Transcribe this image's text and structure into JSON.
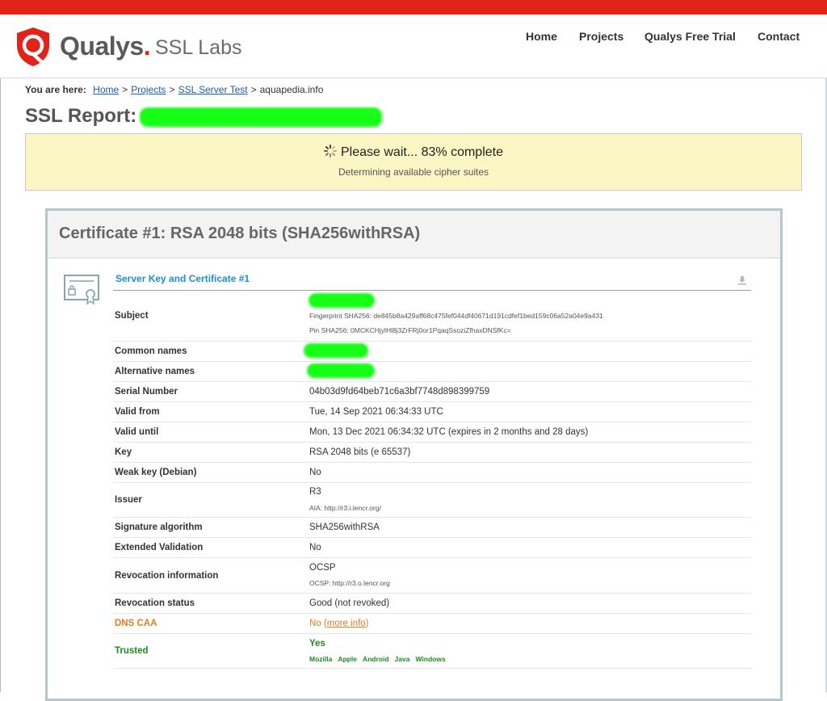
{
  "header": {
    "logo_word": "Qualys",
    "logo_dot": ".",
    "logo_sub": "SSL Labs",
    "nav": [
      "Home",
      "Projects",
      "Qualys Free Trial",
      "Contact"
    ]
  },
  "breadcrumb": {
    "label": "You are here:",
    "links": [
      "Home",
      "Projects",
      "SSL Server Test"
    ],
    "separator": ">",
    "current": "aquapedia.info"
  },
  "report": {
    "title": "SSL Report:"
  },
  "progress": {
    "main": "Please wait... 83% complete",
    "sub": "Determining available cipher suites",
    "percent": 83
  },
  "certificate": {
    "title": "Certificate #1: RSA 2048 bits (SHA256withRSA)",
    "section_title": "Server Key and Certificate #1",
    "rows": {
      "subject": {
        "label": "Subject",
        "fingerprint": "Fingerprint SHA256: de845b8a429aff68c475fef044df40671d191cdfef1bed159c06a52a04e9a431",
        "pin": "Pin SHA256: 0MCKCHjylHl8j3ZrFRj0or1PqaqSsoziZfhaxDNSfKc="
      },
      "common_names": {
        "label": "Common names"
      },
      "alternative_names": {
        "label": "Alternative names"
      },
      "serial": {
        "label": "Serial Number",
        "value": "04b03d9fd64beb71c6a3bf7748d898399759"
      },
      "valid_from": {
        "label": "Valid from",
        "value": "Tue, 14 Sep 2021 06:34:33 UTC"
      },
      "valid_until": {
        "label": "Valid until",
        "value": "Mon, 13 Dec 2021 06:34:32 UTC (expires in 2 months and 28 days)"
      },
      "key": {
        "label": "Key",
        "value": "RSA 2048 bits (e 65537)"
      },
      "weak_key": {
        "label": "Weak key (Debian)",
        "value": "No"
      },
      "issuer": {
        "label": "Issuer",
        "value": "R3",
        "sub": "AIA: http://r3.i.lencr.org/"
      },
      "sig_alg": {
        "label": "Signature algorithm",
        "value": "SHA256withRSA"
      },
      "ev": {
        "label": "Extended Validation",
        "value": "No"
      },
      "revocation_info": {
        "label": "Revocation information",
        "value": "OCSP",
        "sub": "OCSP: http://r3.o.lencr.org"
      },
      "revocation_status": {
        "label": "Revocation status",
        "value": "Good (not revoked)"
      },
      "dns_caa": {
        "label": "DNS CAA",
        "value": "No (",
        "link": "more info",
        "value_end": ")"
      },
      "trusted": {
        "label": "Trusted",
        "value": "Yes",
        "stores": [
          "Mozilla",
          "Apple",
          "Android",
          "Java",
          "Windows"
        ]
      }
    }
  },
  "colors": {
    "brand_red": "#e2231a",
    "link_blue": "#1a5bb5",
    "section_blue": "#1a8fd6",
    "warning_orange": "#ea7a1e",
    "trusted_green": "#1f8a1f",
    "redaction_green": "#17ff17",
    "progress_bg": "#fbf6c4"
  }
}
